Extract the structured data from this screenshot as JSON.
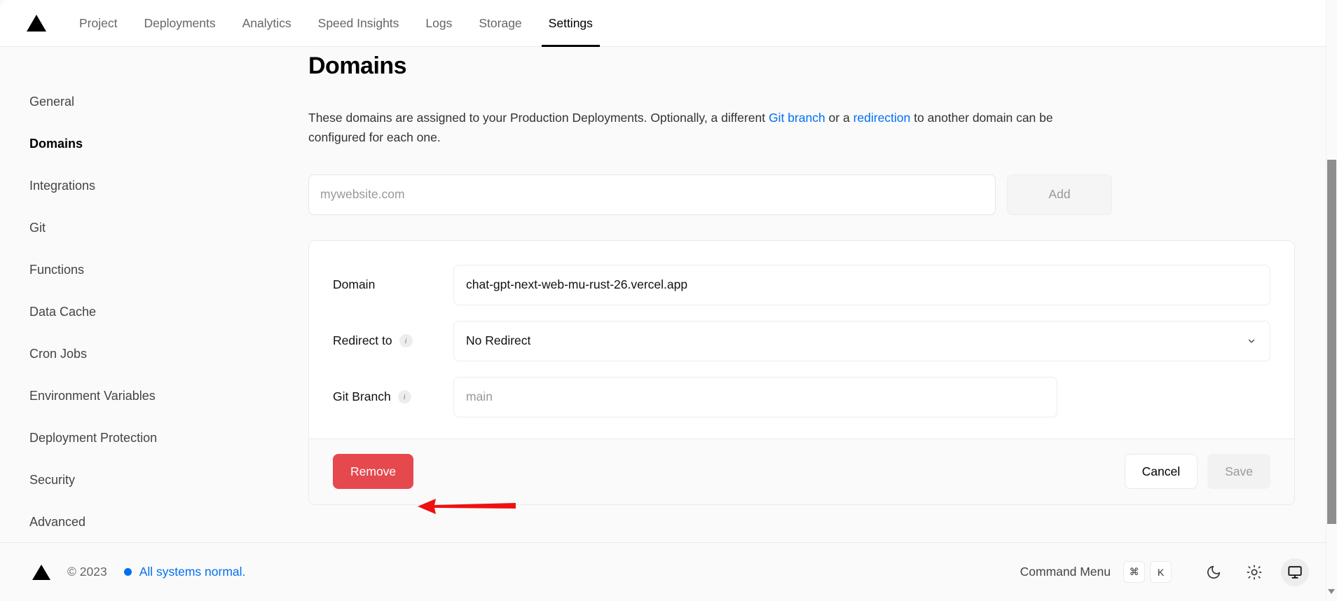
{
  "topnav": {
    "logo_icon": "vercel-triangle-logo",
    "items": [
      {
        "label": "Project",
        "active": false
      },
      {
        "label": "Deployments",
        "active": false
      },
      {
        "label": "Analytics",
        "active": false
      },
      {
        "label": "Speed Insights",
        "active": false
      },
      {
        "label": "Logs",
        "active": false
      },
      {
        "label": "Storage",
        "active": false
      },
      {
        "label": "Settings",
        "active": true
      }
    ]
  },
  "sidebar": {
    "items": [
      {
        "label": "General"
      },
      {
        "label": "Domains"
      },
      {
        "label": "Integrations"
      },
      {
        "label": "Git"
      },
      {
        "label": "Functions"
      },
      {
        "label": "Data Cache"
      },
      {
        "label": "Cron Jobs"
      },
      {
        "label": "Environment Variables"
      },
      {
        "label": "Deployment Protection"
      },
      {
        "label": "Security"
      },
      {
        "label": "Advanced"
      }
    ]
  },
  "main": {
    "title": "Domains",
    "description": {
      "part1": "These domains are assigned to your Production Deployments. Optionally, a different ",
      "link1": "Git branch",
      "part2": " or a ",
      "link2": "redirection",
      "part3": " to another domain can be configured for each one."
    },
    "add_domain": {
      "input_placeholder": "mywebsite.com",
      "input_value": "",
      "add_label": "Add"
    },
    "domain_card": {
      "domain_label": "Domain",
      "domain_value": "chat-gpt-next-web-mu-rust-26.vercel.app",
      "redirect_label": "Redirect to",
      "redirect_value": "No Redirect",
      "redirect_options": [
        "No Redirect"
      ],
      "git_branch_label": "Git Branch",
      "git_branch_placeholder": "main",
      "git_branch_value": "",
      "info_glyph": "i",
      "remove_label": "Remove",
      "cancel_label": "Cancel",
      "save_label": "Save"
    }
  },
  "footer": {
    "logo_icon": "vercel-triangle-logo",
    "copyright": "© 2023",
    "status_text": "All systems normal.",
    "command_menu_label": "Command Menu",
    "kbd_cmd": "⌘",
    "kbd_key": "K",
    "theme_icons": [
      "moon-icon",
      "sun-icon",
      "monitor-icon"
    ]
  },
  "colors": {
    "accent_blue": "#0070f3",
    "danger_red": "#e5484d",
    "annotation_red": "#ee1111",
    "border": "#eaeaea",
    "bg": "#fafafa"
  },
  "annotation": {
    "arrow": "red-arrow-pointing-to-remove-button"
  }
}
